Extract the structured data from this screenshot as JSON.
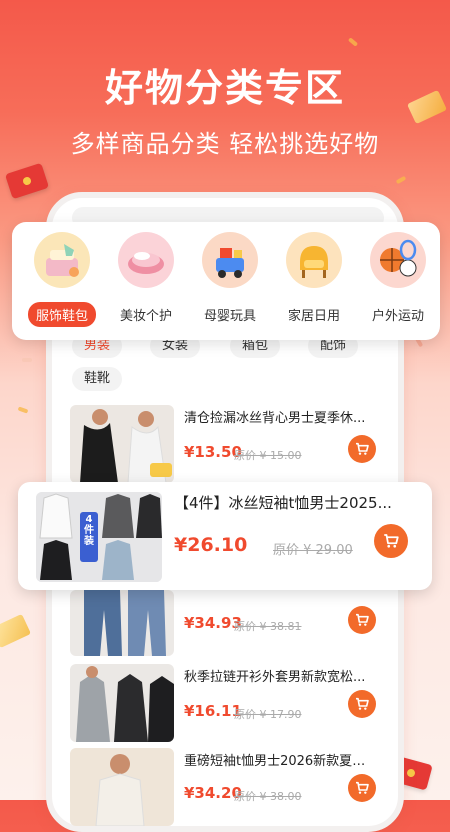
{
  "header": {
    "title": "好物分类专区",
    "subtitle": "多样商品分类 轻松挑选好物"
  },
  "categories": [
    {
      "label": "服饰鞋包",
      "icon": "clothing-icon",
      "active": true
    },
    {
      "label": "美妆个护",
      "icon": "cosmetics-icon",
      "active": false
    },
    {
      "label": "母婴玩具",
      "icon": "toys-icon",
      "active": false
    },
    {
      "label": "家居日用",
      "icon": "home-icon",
      "active": false
    },
    {
      "label": "户外运动",
      "icon": "sports-icon",
      "active": false
    }
  ],
  "subtabs": [
    "男装",
    "女装",
    "箱包",
    "配饰",
    "鞋靴"
  ],
  "featured": {
    "title": "【4件】冰丝短袖t恤男士2025...",
    "price": "¥26.10",
    "original": "原价 ¥ 29.00",
    "badge": "4件装"
  },
  "products": [
    {
      "title": "清仓捡漏冰丝背心男士夏季休...",
      "price": "¥13.50",
      "original": "原价 ¥ 15.00"
    },
    {
      "title": "",
      "price": "¥34.93",
      "original": "原价 ¥ 38.81"
    },
    {
      "title": "秋季拉链开衫外套男新款宽松...",
      "price": "¥16.11",
      "original": "原价 ¥ 17.90"
    },
    {
      "title": "重磅短袖t恤男士2026新款夏季...",
      "price": "¥34.20",
      "original": "原价 ¥ 38.00"
    }
  ],
  "colors": {
    "accent": "#f04a2e",
    "cart": "#f26a2a"
  }
}
